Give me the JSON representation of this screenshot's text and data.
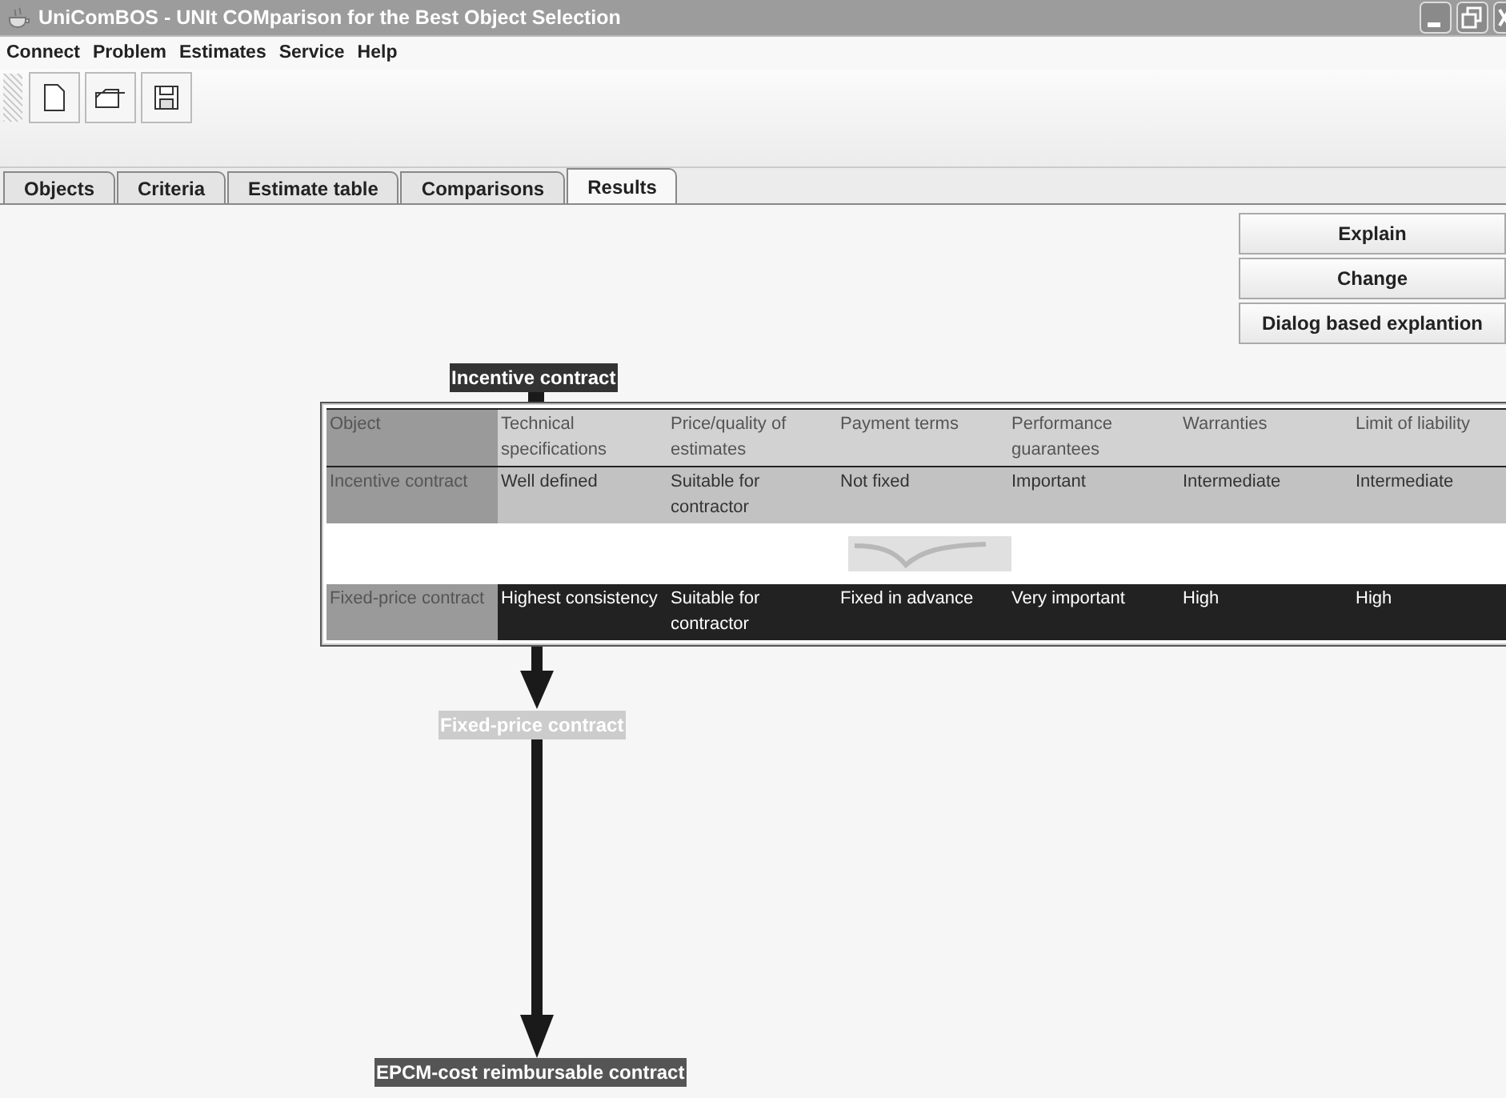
{
  "window": {
    "title": "UniComBOS - UNIt COMparison for the Best Object Selection"
  },
  "menu": [
    "Connect",
    "Problem",
    "Estimates",
    "Service",
    "Help"
  ],
  "tabs": [
    {
      "label": "Objects",
      "selected": false
    },
    {
      "label": "Criteria",
      "selected": false
    },
    {
      "label": "Estimate table",
      "selected": false
    },
    {
      "label": "Comparisons",
      "selected": false
    },
    {
      "label": "Results",
      "selected": true
    }
  ],
  "actions": [
    "Explain",
    "Change",
    "Dialog based explantion"
  ],
  "diagram": {
    "nodes": [
      {
        "label": "Incentive contract",
        "color": "#333333"
      },
      {
        "label": "Fixed-price contract",
        "color": "#cccccc"
      },
      {
        "label": "EPCM-cost reimbursable contract",
        "color": "#555555"
      }
    ],
    "table": {
      "columns": [
        "Object",
        "Technical specifications",
        "Price/quality of estimates",
        "Payment terms",
        "Performance guarantees",
        "Warranties",
        "Limit of liability"
      ],
      "rows": [
        {
          "highlighted": false,
          "cells": [
            "Incentive contract",
            "Well defined",
            "Suitable for contractor",
            "Not fixed",
            "Important",
            "Intermediate",
            "Intermediate"
          ]
        },
        {
          "highlighted": true,
          "cells": [
            "Fixed-price contract",
            "Highest consistency",
            "Suitable for contractor",
            "Fixed in advance",
            "Very important",
            "High",
            "High"
          ]
        }
      ]
    }
  }
}
